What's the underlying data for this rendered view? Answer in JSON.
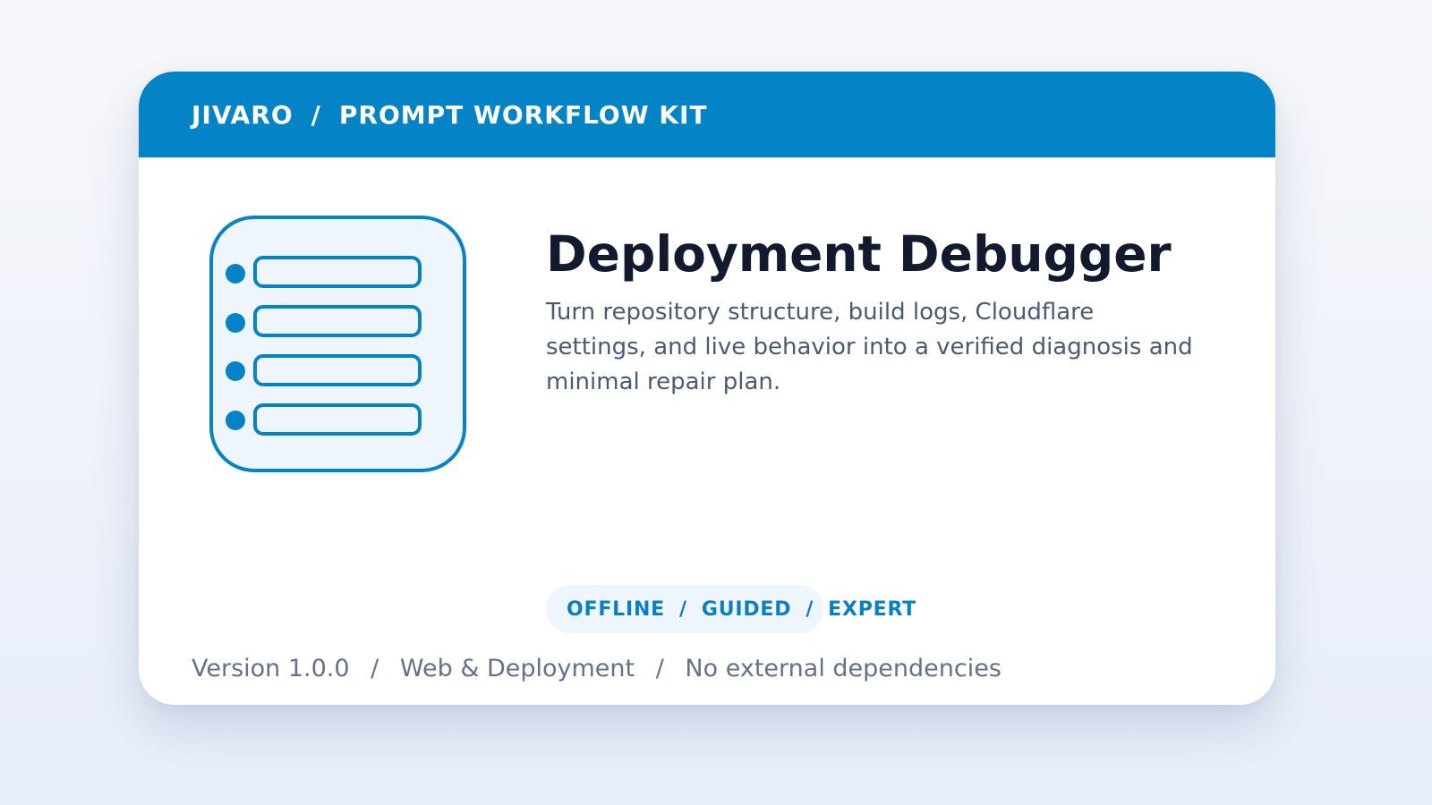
{
  "brand": {
    "name": "JIVARO",
    "separator": "/",
    "product": "PROMPT WORKFLOW KIT"
  },
  "app_icon": "list-checklist-icon",
  "title": "Deployment Debugger",
  "description": "Turn repository structure, build logs, Cloudflare settings, and live behavior into a verified diagnosis and minimal repair plan.",
  "tags": {
    "items": [
      "OFFLINE",
      "GUIDED",
      "EXPERT"
    ],
    "separator": "/"
  },
  "footer": {
    "version": "Version 1.0.0",
    "category": "Web & Deployment",
    "dependencies": "No external dependencies",
    "separator": "/"
  },
  "colors": {
    "accent": "#0484c7",
    "title": "#111a2e",
    "icon_fill": "#eef5fd"
  }
}
